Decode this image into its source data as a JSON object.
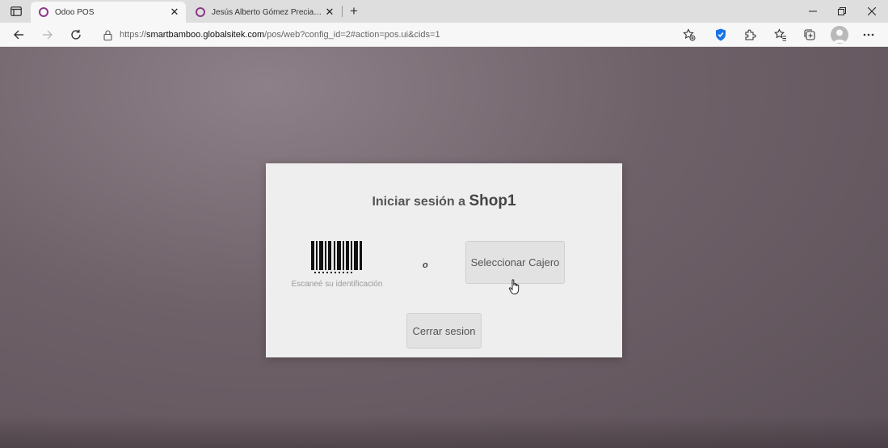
{
  "browser": {
    "tabs": [
      {
        "title": "Odoo POS",
        "active": true
      },
      {
        "title": "Jesús Alberto Gómez Preciado - ",
        "active": false
      }
    ],
    "close_glyph": "✕",
    "new_tab_glyph": "+",
    "url_prefix": "https://",
    "url_host": "smartbamboo.globalsitek.com",
    "url_path": "/pos/web?config_id=2#action=pos.ui&cids=1"
  },
  "login": {
    "title_prefix": "Iniciar sesión a ",
    "shop_name": "Shop1",
    "scan_label": "Escaneé su identificación",
    "or_text": "o",
    "select_cashier_label": "Seleccionar Cajero",
    "close_session_label": "Cerrar sesion"
  },
  "colors": {
    "favicon": "#8a3a87",
    "shield": "#1a73e8",
    "background": "#6f6168"
  }
}
